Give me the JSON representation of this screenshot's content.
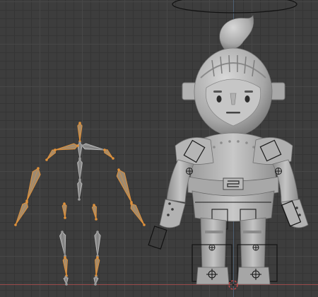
{
  "viewport": {
    "mode": "pose",
    "background_color": "#3d3d3d",
    "grid_color": "#474747",
    "x_axis_color": "#9a4a4a",
    "y_axis_color": "#5a7a9a"
  },
  "armature": {
    "bone_color": "#b8b8b8",
    "selected_bone_color": "#e0913a"
  },
  "character": {
    "body_color": "#bdbdbd",
    "shadow_color": "#8a8a8a",
    "outline_color": "#2a2a2a"
  },
  "gizmos": {
    "camera_ring_icon": "ring-icon",
    "origin_icon": "origin-cursor-icon"
  }
}
